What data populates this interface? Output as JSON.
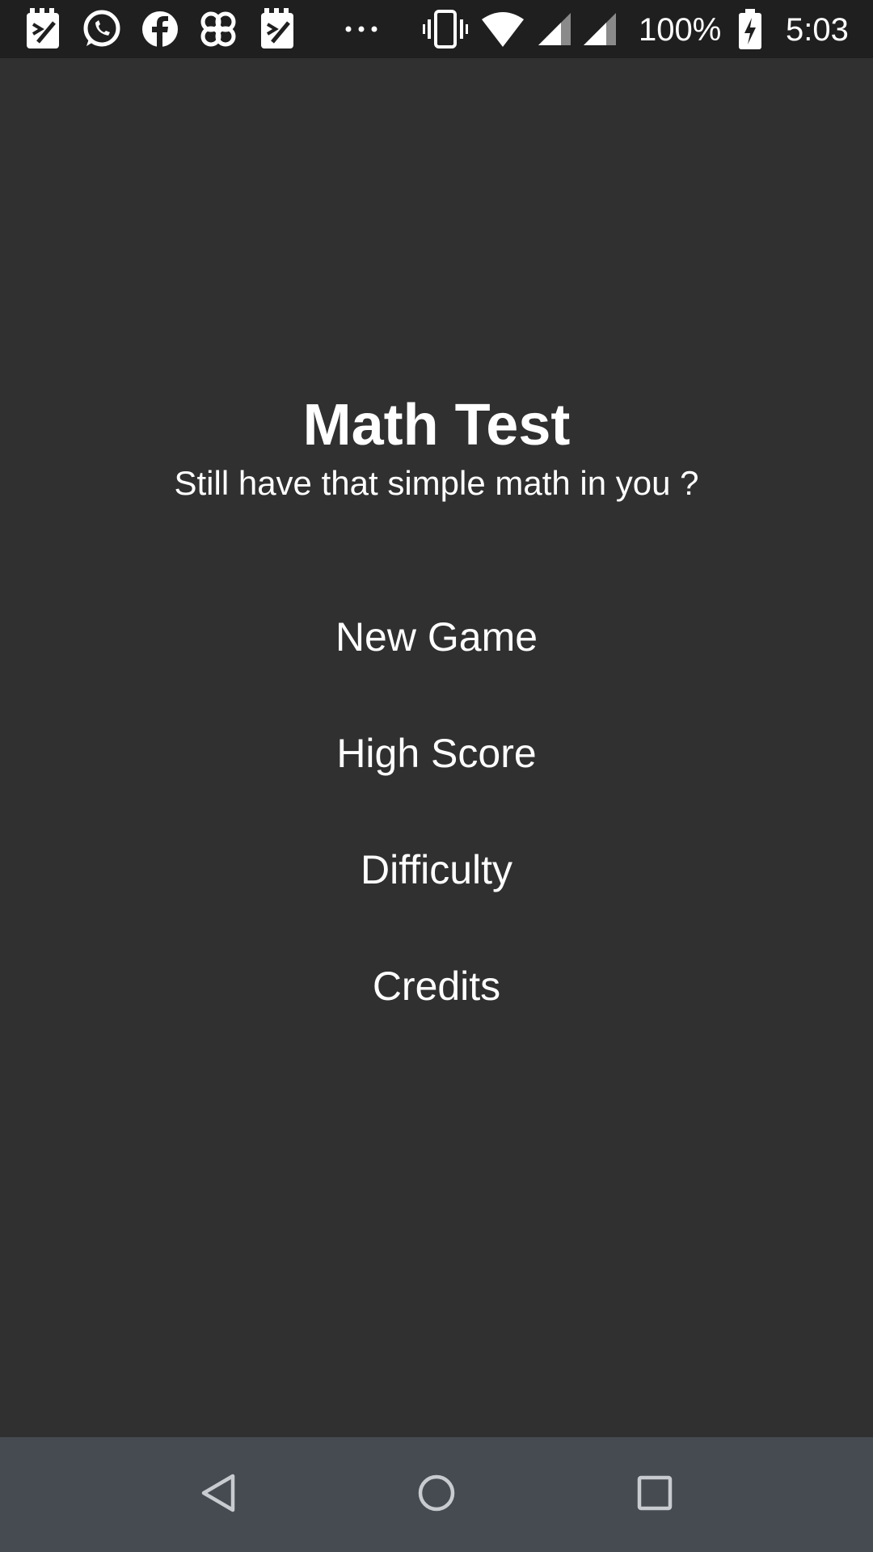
{
  "status_bar": {
    "notification_icons": [
      "notepad-icon",
      "whatsapp-icon",
      "facebook-icon",
      "clover-icon",
      "notepad-icon",
      "more-dots-icon"
    ],
    "system_icons": [
      "vibrate-icon",
      "wifi-icon",
      "signal-icon",
      "signal-icon"
    ],
    "battery_percent": "100%",
    "time": "5:03"
  },
  "app": {
    "title": "Math Test",
    "subtitle": "Still have that simple math in you ?"
  },
  "menu": {
    "items": [
      {
        "label": "New Game"
      },
      {
        "label": "High Score"
      },
      {
        "label": "Difficulty"
      },
      {
        "label": "Credits"
      }
    ]
  },
  "nav_bar": {
    "buttons": [
      "back-icon",
      "home-icon",
      "recents-icon"
    ]
  },
  "colors": {
    "background": "#303030",
    "status_bar": "#1f1f1f",
    "nav_bar": "#454b51",
    "text": "#ffffff"
  }
}
